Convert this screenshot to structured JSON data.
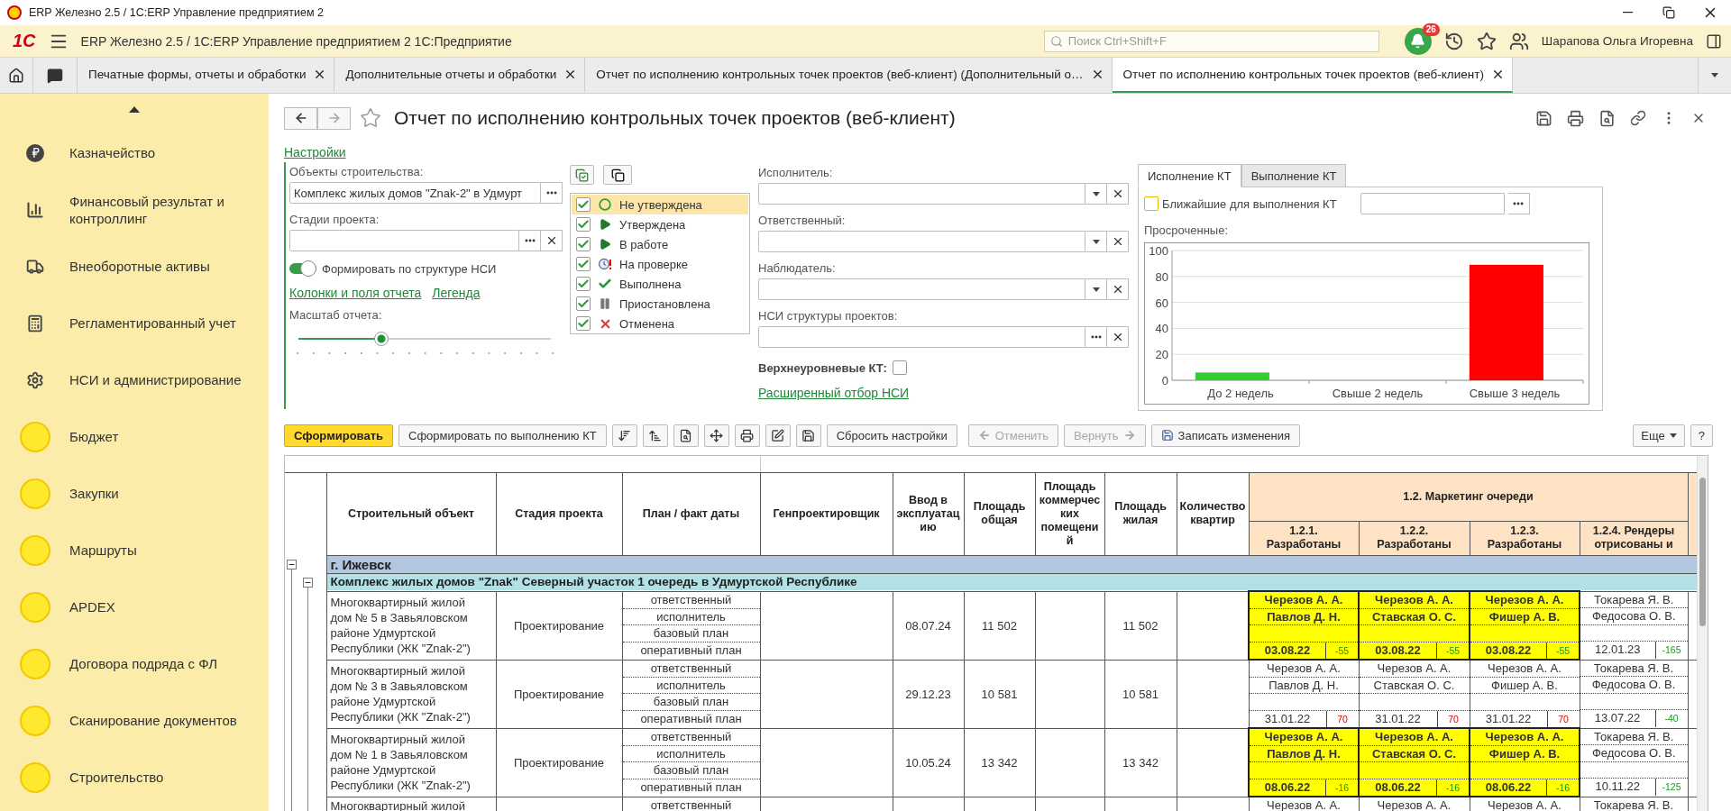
{
  "window": {
    "title": "ERP Железно 2.5 / 1С:ERP Управление предприятием 2"
  },
  "app_bar": {
    "logo": "1С",
    "title": "ERP Железно 2.5 / 1С:ERP Управление предприятием 2 1С:Предприятие",
    "search": {
      "placeholder": "Поиск Ctrl+Shift+F"
    },
    "notifications": "26",
    "user": "Шарапова Ольга Игоревна"
  },
  "tabs": [
    {
      "label": "Печатные формы, отчеты и обработки",
      "selected": false
    },
    {
      "label": "Дополнительные отчеты и обработки",
      "selected": false
    },
    {
      "label": "Отчет по исполнению контрольных точек проектов (веб-клиент) (Дополнительный о…",
      "selected": false
    },
    {
      "label": "Отчет по исполнению контрольных точек проектов (веб-клиент)",
      "selected": true
    }
  ],
  "sidebar": {
    "items": [
      {
        "label": "Казначейство",
        "kind": "icon"
      },
      {
        "label": "Финансовый результат и контроллинг",
        "kind": "icon"
      },
      {
        "label": "Внеоборотные активы",
        "kind": "icon"
      },
      {
        "label": "Регламентированный учет",
        "kind": "icon"
      },
      {
        "label": "НСИ и администрирование",
        "kind": "icon"
      },
      {
        "label": "Бюджет",
        "kind": "circle"
      },
      {
        "label": "Закупки",
        "kind": "circle"
      },
      {
        "label": "Маршруты",
        "kind": "circle"
      },
      {
        "label": "APDEX",
        "kind": "circle"
      },
      {
        "label": "Договора подряда с ФЛ",
        "kind": "circle"
      },
      {
        "label": "Сканирование документов",
        "kind": "circle"
      },
      {
        "label": "Строительство",
        "kind": "circle"
      }
    ]
  },
  "form": {
    "title": "Отчет по исполнению контрольных точек проектов (веб-клиент)",
    "settings_link": "Настройки"
  },
  "filters": {
    "objects": {
      "label": "Объекты строительства:",
      "value": "Комплекс жилых домов \"Znak-2\" в Удмурт"
    },
    "stages": {
      "label": "Стадии проекта:"
    },
    "nsi_toggle": {
      "label": "Формировать по структуре НСИ",
      "on": true
    },
    "links": [
      "Колонки и поля отчета",
      "Легенда"
    ],
    "scale": {
      "label": "Масштаб отчета:",
      "level": 0.33
    },
    "statuses": [
      {
        "label": "Не утверждена",
        "checked": true,
        "selected": true
      },
      {
        "label": "Утверждена",
        "checked": true,
        "selected": false
      },
      {
        "label": "В работе",
        "checked": true,
        "selected": false
      },
      {
        "label": "На проверке",
        "checked": true,
        "selected": false
      },
      {
        "label": "Выполнена",
        "checked": true,
        "selected": false
      },
      {
        "label": "Приостановлена",
        "checked": true,
        "selected": false
      },
      {
        "label": "Отменена",
        "checked": true,
        "selected": false
      }
    ],
    "people_fields": [
      {
        "label": "Исполнитель:",
        "kind": "dropdown"
      },
      {
        "label": "Ответственный:",
        "kind": "dropdown"
      },
      {
        "label": "Наблюдатель:",
        "kind": "dropdown"
      },
      {
        "label": "НСИ структуры проектов:",
        "kind": "choice"
      }
    ],
    "top_level": {
      "label": "Верхнеуровневые КТ:",
      "checked": false
    },
    "advanced_link": "Расширенный отбор НСИ"
  },
  "overdue_panel": {
    "tabs": [
      {
        "label": "Исполнение КТ",
        "selected": true
      },
      {
        "label": "Выполнение КТ",
        "selected": false
      }
    ],
    "nearest": {
      "label": "Ближайшие для выполнения КТ",
      "checked": false
    },
    "chart_label": "Просроченные:",
    "chart_data": {
      "type": "bar",
      "categories": [
        "До 2 недель",
        "Свыше 2 недель",
        "Свыше 3 недель"
      ],
      "stacked": true,
      "grid": true,
      "series": [
        {
          "color": "#33cc33",
          "values": [
            6,
            null,
            null
          ]
        },
        {
          "color": "#ff0000",
          "values": [
            null,
            0,
            89
          ]
        }
      ],
      "ylim": [
        0,
        100
      ],
      "yticks": [
        0,
        20,
        40,
        60,
        80,
        100
      ]
    }
  },
  "toolbar": {
    "primary": "Сформировать",
    "secondary": "Сформировать по выполнению КТ",
    "reset": "Сбросить настройки",
    "undo": {
      "label": "Отменить",
      "disabled": true
    },
    "redo": {
      "label": "Вернуть",
      "disabled": true
    },
    "save": "Записать изменения",
    "more": "Еще",
    "help": "?"
  },
  "report": {
    "columns": [
      "Строительный объект",
      "Стадия проекта",
      "План / факт даты",
      "Генпроектировщик",
      "Ввод в эксплуатацию",
      "Площадь общая",
      "Площадь коммерческих помещений",
      "Площадь жилая",
      "Количество квартир"
    ],
    "group_header": "1.2. Маркетинг очереди",
    "milestones": [
      "1.2.1. Разработаны",
      "1.2.2. Разработаны",
      "1.2.3. Разработаны",
      "1.2.4. Рендеры отрисованы и"
    ],
    "tree": [
      {
        "title": "г. Ижевск",
        "expanded": true,
        "children": [
          {
            "title": "Комплекс жилых домов \"Znak\" Северный участок 1 очередь в Удмуртской Республике",
            "expanded": true,
            "rows": [
              {
                "object": "Многоквартирный жилой дом № 5 в Завьяловском районе Удмуртской Республики (ЖК \"Znak-2\")",
                "stage": "Проектирование",
                "roles": [
                  "ответственный",
                  "исполнитель",
                  "базовый план",
                  "оперативный план"
                ],
                "commissioning": "08.07.24",
                "area_total": "11 502",
                "area_living": "11 502",
                "milestones": [
                  {
                    "highlighted": true,
                    "responsible": "Черезов А. А.",
                    "executor": "Павлов Д. Н.",
                    "date": "03.08.22",
                    "delta": "-55",
                    "late": false
                  },
                  {
                    "highlighted": true,
                    "responsible": "Черезов А. А.",
                    "executor": "Ставская О. С.",
                    "date": "03.08.22",
                    "delta": "-55",
                    "late": false
                  },
                  {
                    "highlighted": true,
                    "responsible": "Черезов А. А.",
                    "executor": "Фишер А. В.",
                    "date": "03.08.22",
                    "delta": "-55",
                    "late": false
                  },
                  {
                    "highlighted": false,
                    "responsible": "Токарева Я. В.",
                    "executor": "Федосова О. В.",
                    "date": "12.01.23",
                    "delta": "-165",
                    "late": false
                  }
                ]
              },
              {
                "object": "Многоквартирный жилой дом № 3 в Завьяловском районе Удмуртской Республики (ЖК \"Znak-2\")",
                "stage": "Проектирование",
                "roles": [
                  "ответственный",
                  "исполнитель",
                  "базовый план",
                  "оперативный план"
                ],
                "commissioning": "29.12.23",
                "area_total": "10 581",
                "area_living": "10 581",
                "milestones": [
                  {
                    "highlighted": false,
                    "responsible": "Черезов А. А.",
                    "executor": "Павлов Д. Н.",
                    "date": "31.01.22",
                    "delta": "70",
                    "late": true
                  },
                  {
                    "highlighted": false,
                    "responsible": "Черезов А. А.",
                    "executor": "Ставская О. С.",
                    "date": "31.01.22",
                    "delta": "70",
                    "late": true
                  },
                  {
                    "highlighted": false,
                    "responsible": "Черезов А. А.",
                    "executor": "Фишер А. В.",
                    "date": "31.01.22",
                    "delta": "70",
                    "late": true
                  },
                  {
                    "highlighted": false,
                    "responsible": "Токарева Я. В.",
                    "executor": "Федосова О. В.",
                    "date": "13.07.22",
                    "delta": "-40",
                    "late": false
                  }
                ]
              },
              {
                "object": "Многоквартирный жилой дом № 1 в Завьяловском районе Удмуртской Республики (ЖК \"Znak-2\")",
                "stage": "Проектирование",
                "roles": [
                  "ответственный",
                  "исполнитель",
                  "базовый план",
                  "оперативный план"
                ],
                "commissioning": "10.05.24",
                "area_total": "13 342",
                "area_living": "13 342",
                "milestones": [
                  {
                    "highlighted": true,
                    "responsible": "Черезов А. А.",
                    "executor": "Павлов Д. Н.",
                    "date": "08.06.22",
                    "delta": "-16",
                    "late": false
                  },
                  {
                    "highlighted": true,
                    "responsible": "Черезов А. А.",
                    "executor": "Ставская О. С.",
                    "date": "08.06.22",
                    "delta": "-16",
                    "late": false
                  },
                  {
                    "highlighted": true,
                    "responsible": "Черезов А. А.",
                    "executor": "Фишер А. В.",
                    "date": "08.06.22",
                    "delta": "-16",
                    "late": false
                  },
                  {
                    "highlighted": false,
                    "responsible": "Токарева Я. В.",
                    "executor": "Федосова О. В.",
                    "date": "10.11.22",
                    "delta": "-125",
                    "late": false
                  }
                ]
              },
              {
                "object": "Многоквартирный жилой",
                "roles": [
                  "ответственный"
                ],
                "milestones": [
                  {
                    "highlighted": false,
                    "responsible": "Черезов А. А."
                  },
                  {
                    "highlighted": false,
                    "responsible": "Черезов А. А."
                  },
                  {
                    "highlighted": false,
                    "responsible": "Черезов А. А."
                  },
                  {
                    "highlighted": false,
                    "responsible": "Токарева Я. В."
                  }
                ]
              }
            ]
          }
        ]
      }
    ]
  }
}
